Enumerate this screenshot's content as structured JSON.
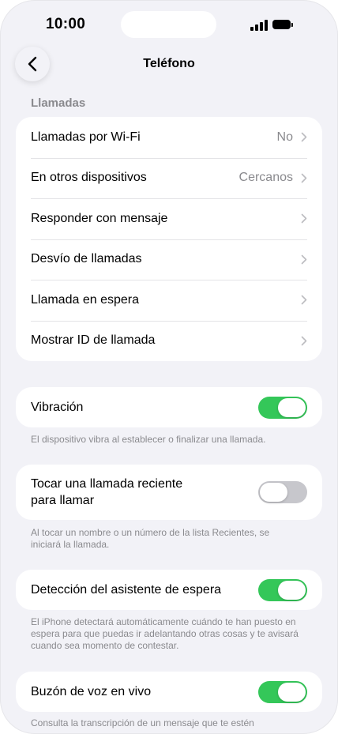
{
  "status": {
    "time": "10:00"
  },
  "nav": {
    "title": "Teléfono"
  },
  "calls": {
    "header": "Llamadas",
    "rows": [
      {
        "label": "Llamadas por Wi-Fi",
        "value": "No"
      },
      {
        "label": "En otros dispositivos",
        "value": "Cercanos"
      },
      {
        "label": "Responder con mensaje",
        "value": ""
      },
      {
        "label": "Desvío de llamadas",
        "value": ""
      },
      {
        "label": "Llamada en espera",
        "value": ""
      },
      {
        "label": "Mostrar ID de llamada",
        "value": ""
      }
    ]
  },
  "toggles": [
    {
      "label": "Vibración",
      "on": true,
      "footnote": "El dispositivo vibra al establecer o finalizar una llamada."
    },
    {
      "label": "Tocar una llamada reciente para llamar",
      "on": false,
      "footnote": "Al tocar un nombre o un número de la lista Recientes, se iniciará la llamada."
    },
    {
      "label": "Detección del asistente de espera",
      "on": true,
      "footnote": "El iPhone detectará automáticamente cuándo te han puesto en espera para que puedas ir adelantando otras cosas y te avisará cuando sea momento de contestar."
    },
    {
      "label": "Buzón de voz en vivo",
      "on": true,
      "footnote": "Consulta la transcripción de un mensaje que te estén"
    }
  ],
  "colors": {
    "toggle_on": "#34c759",
    "toggle_off": "#c7c7cc",
    "background": "#f2f2f7"
  }
}
